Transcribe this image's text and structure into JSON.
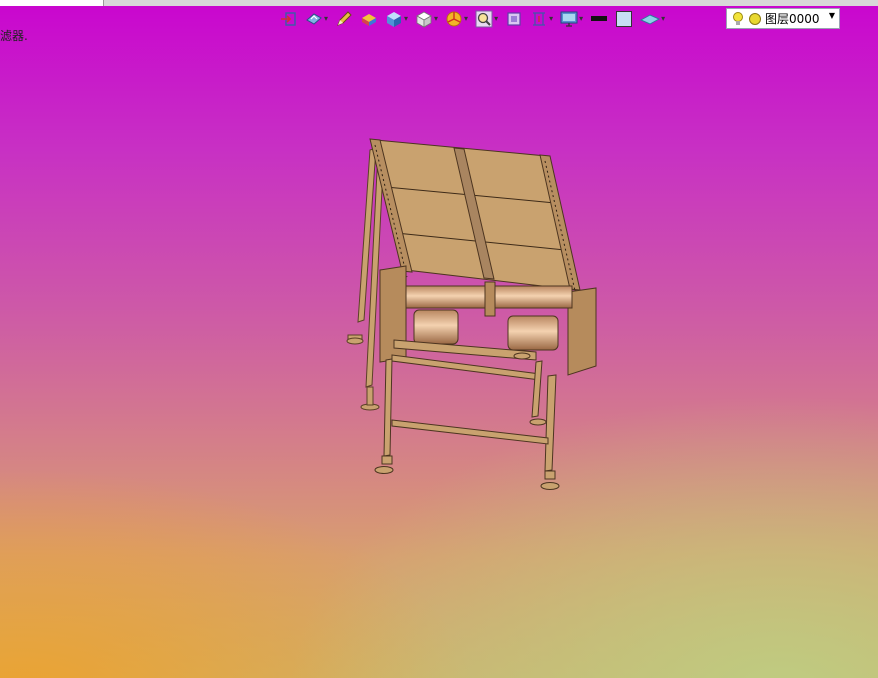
{
  "window": {
    "filter_label": "滤器."
  },
  "toolbar": {
    "items": [
      {
        "icon": "exit-sketch-icon"
      },
      {
        "icon": "view-orientation-icon"
      },
      {
        "icon": "pencil-icon"
      },
      {
        "icon": "shaded-display-icon"
      },
      {
        "icon": "cube-display-icon"
      },
      {
        "icon": "wireframe-cube-icon"
      },
      {
        "icon": "section-view-icon"
      },
      {
        "icon": "zoom-icon"
      },
      {
        "icon": "fit-view-icon"
      },
      {
        "icon": "dimension-icon"
      },
      {
        "icon": "monitor-icon"
      },
      {
        "icon": "line-style-icon"
      },
      {
        "icon": "fill-color-icon"
      },
      {
        "icon": "surface-icon"
      }
    ],
    "layer": {
      "label": "图层0000",
      "lightbulb_color": "#f2e33a",
      "dot_color": "#e8d830"
    }
  },
  "viewport": {
    "background_top": "#c905cf",
    "background_bottom_left": "#f0a028",
    "background_bottom_right": "#bec582",
    "model_color": "#c9a26f"
  }
}
